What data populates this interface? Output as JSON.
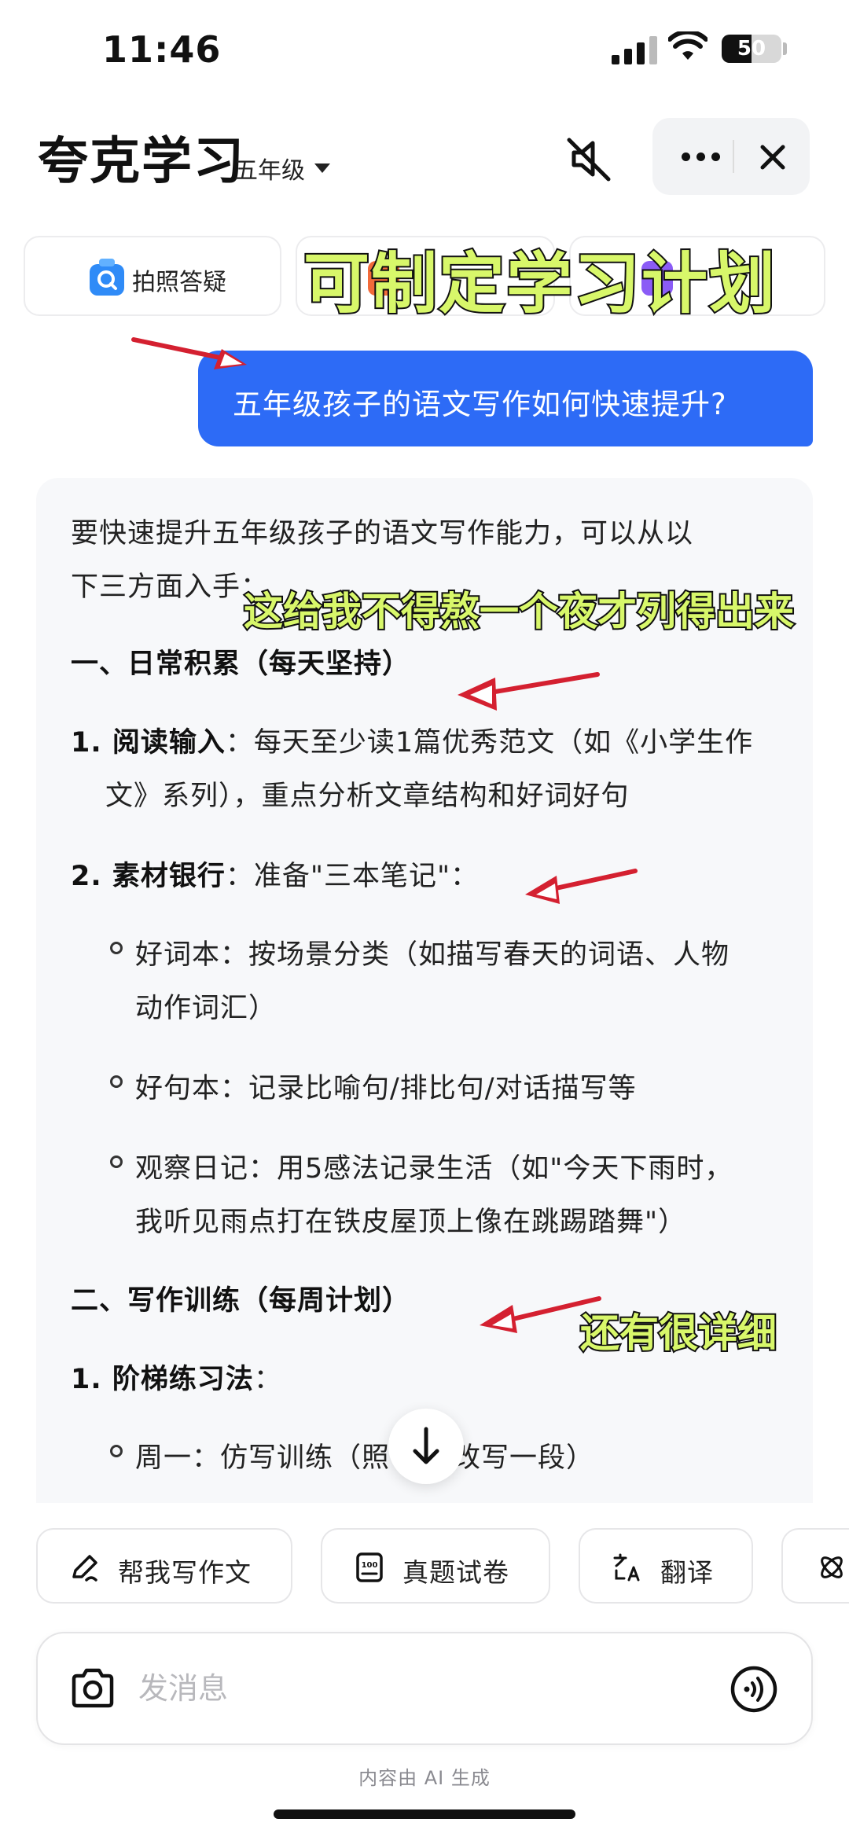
{
  "status": {
    "time": "11:46",
    "battery": "50"
  },
  "header": {
    "title": "夸克学习",
    "grade": "五年级"
  },
  "quick_actions": [
    {
      "label": "拍照答疑"
    },
    {
      "label": ""
    },
    {
      "label": ""
    }
  ],
  "captions": {
    "top": "可制定学习计划",
    "middle": "这给我不得熬一个夜才列得出来",
    "bottom": "还有很详细"
  },
  "chat": {
    "user_message": "五年级孩子的语文写作如何快速提升?",
    "answer": {
      "intro_1": "要快速提升五年级孩子的语文写作能力，可以从以",
      "intro_2": "下三方面入手：",
      "section_1": "一、日常积累（每天坚持）",
      "item_1_num": "1. 阅读输入",
      "item_1_text_a": "：每天至少读1篇优秀范文（如《小学生作",
      "item_1_text_b": "文》系列），重点分析文章结构和好词好句",
      "item_2_num": "2. 素材银行",
      "item_2_text": "：准备\"三本笔记\"：",
      "sub_1_a": "好词本：按场景分类（如描写春天的词语、人物",
      "sub_1_b": "动作词汇）",
      "sub_2": "好句本：记录比喻句/排比句/对话描写等",
      "sub_3_a": "观察日记：用5感法记录生活（如\"今天下雨时，",
      "sub_3_b": "我听见雨点打在铁皮屋顶上像在跳踢踏舞\"）",
      "section_2": "二、写作训练（每周计划）",
      "item_3_num": "1. 阶梯练习法",
      "item_3_text": "：",
      "sub_4_a": "周一：仿写训练（照",
      "sub_4_b": "文改写一段）"
    }
  },
  "tools": [
    {
      "label": "帮我写作文"
    },
    {
      "label": "真题试卷"
    },
    {
      "label": "翻译"
    }
  ],
  "composer": {
    "placeholder": "发消息"
  },
  "footnote": "内容由 AI 生成",
  "colors": {
    "accent": "#2d6bf6",
    "caption": "#d8f76a",
    "arrow": "#d42030"
  }
}
